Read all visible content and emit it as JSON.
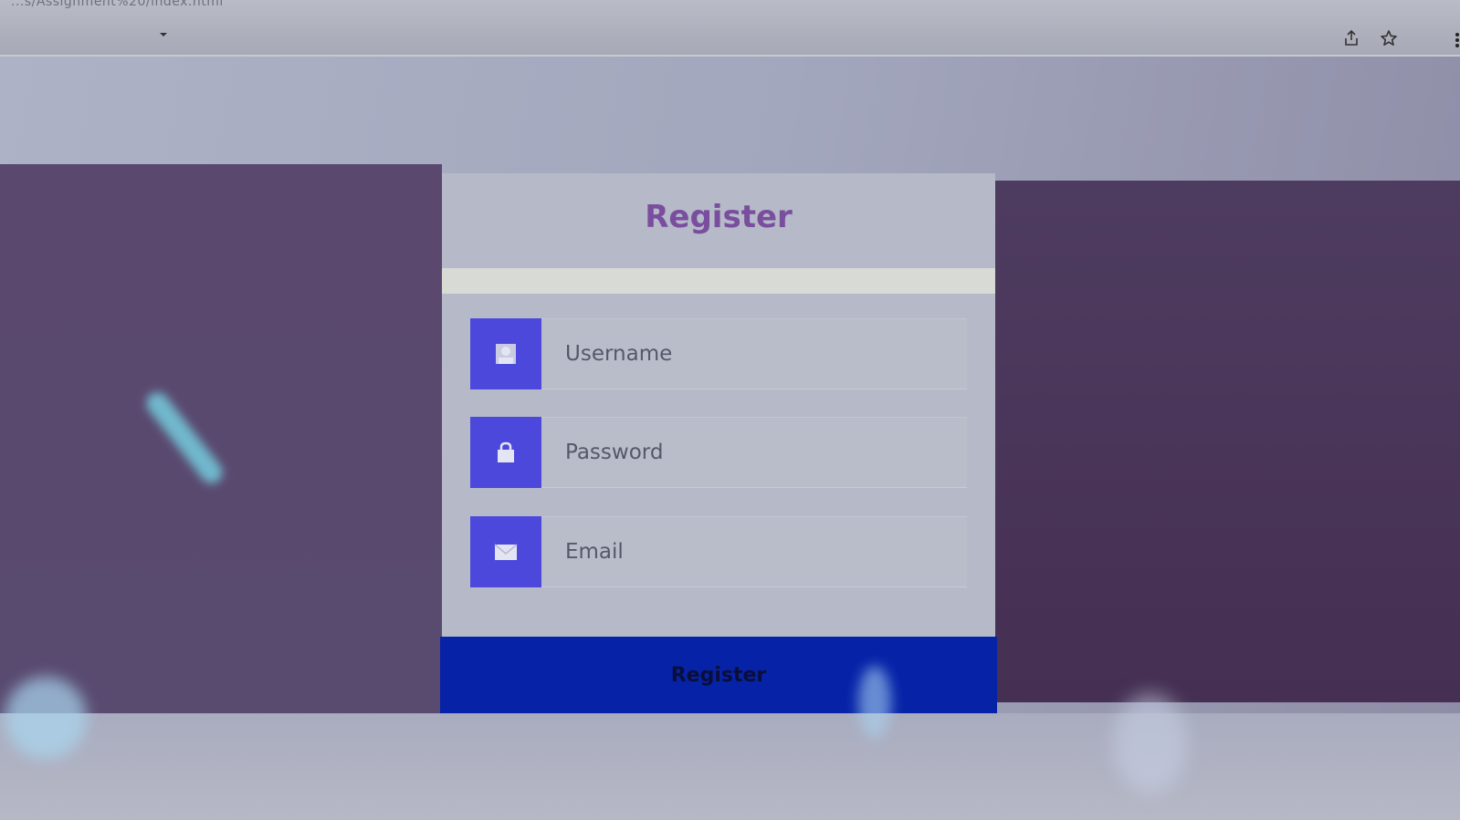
{
  "browser": {
    "url": "...s/Assignment%20/index.html",
    "icons": {
      "share": "share-icon",
      "bookmark": "star-icon",
      "menu": "more-vert-icon"
    }
  },
  "form": {
    "title": "Register",
    "fields": [
      {
        "name": "username",
        "placeholder": "Username",
        "value": "",
        "icon": "user-icon"
      },
      {
        "name": "password",
        "placeholder": "Password",
        "value": "",
        "icon": "lock-icon"
      },
      {
        "name": "email",
        "placeholder": "Email",
        "value": "",
        "icon": "envelope-icon"
      }
    ],
    "submit_label": "Register"
  },
  "colors": {
    "title": "#7a4e9e",
    "icon_box": "#4c48dc",
    "button": "#0623a8",
    "side_panel": "#5a486e"
  }
}
